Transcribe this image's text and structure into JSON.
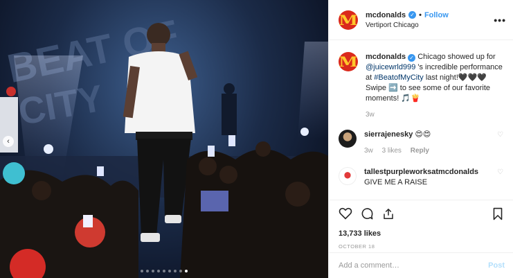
{
  "post": {
    "indicator_count": 9,
    "active_index": 8
  },
  "header": {
    "username": "mcdonalds",
    "follow_separator": "•",
    "follow_label": "Follow",
    "location": "Vertiport Chicago",
    "more_label": "•••",
    "verified_icon": "verified-badge-icon",
    "logo_text": "M"
  },
  "caption": {
    "username": "mcdonalds",
    "text_1": "Chicago showed up for ",
    "mention": "@juicewrld999",
    "text_2": " 's incredible performance at ",
    "hashtag": "#BeatofMyCity",
    "text_3": " last night!🖤🖤🖤Swipe ➡️ to see some of our favorite moments! 🎵🍟",
    "time": "3w"
  },
  "comments": [
    {
      "username": "sierrajenesky",
      "text": "😍😍",
      "time": "3w",
      "likes": "3 likes",
      "reply": "Reply"
    },
    {
      "username": "tallestpurpleworksatmcdonalds",
      "text": "GIVE ME A RAISE"
    }
  ],
  "stats": {
    "likes": "13,733 likes",
    "date": "OCTOBER 18"
  },
  "composer": {
    "placeholder": "Add a comment…",
    "post_label": "Post"
  },
  "colors": {
    "accent": "#3897f0",
    "mcd_red": "#da291c",
    "mcd_yellow": "#ffc72c",
    "post_disabled": "#b2dffc"
  }
}
